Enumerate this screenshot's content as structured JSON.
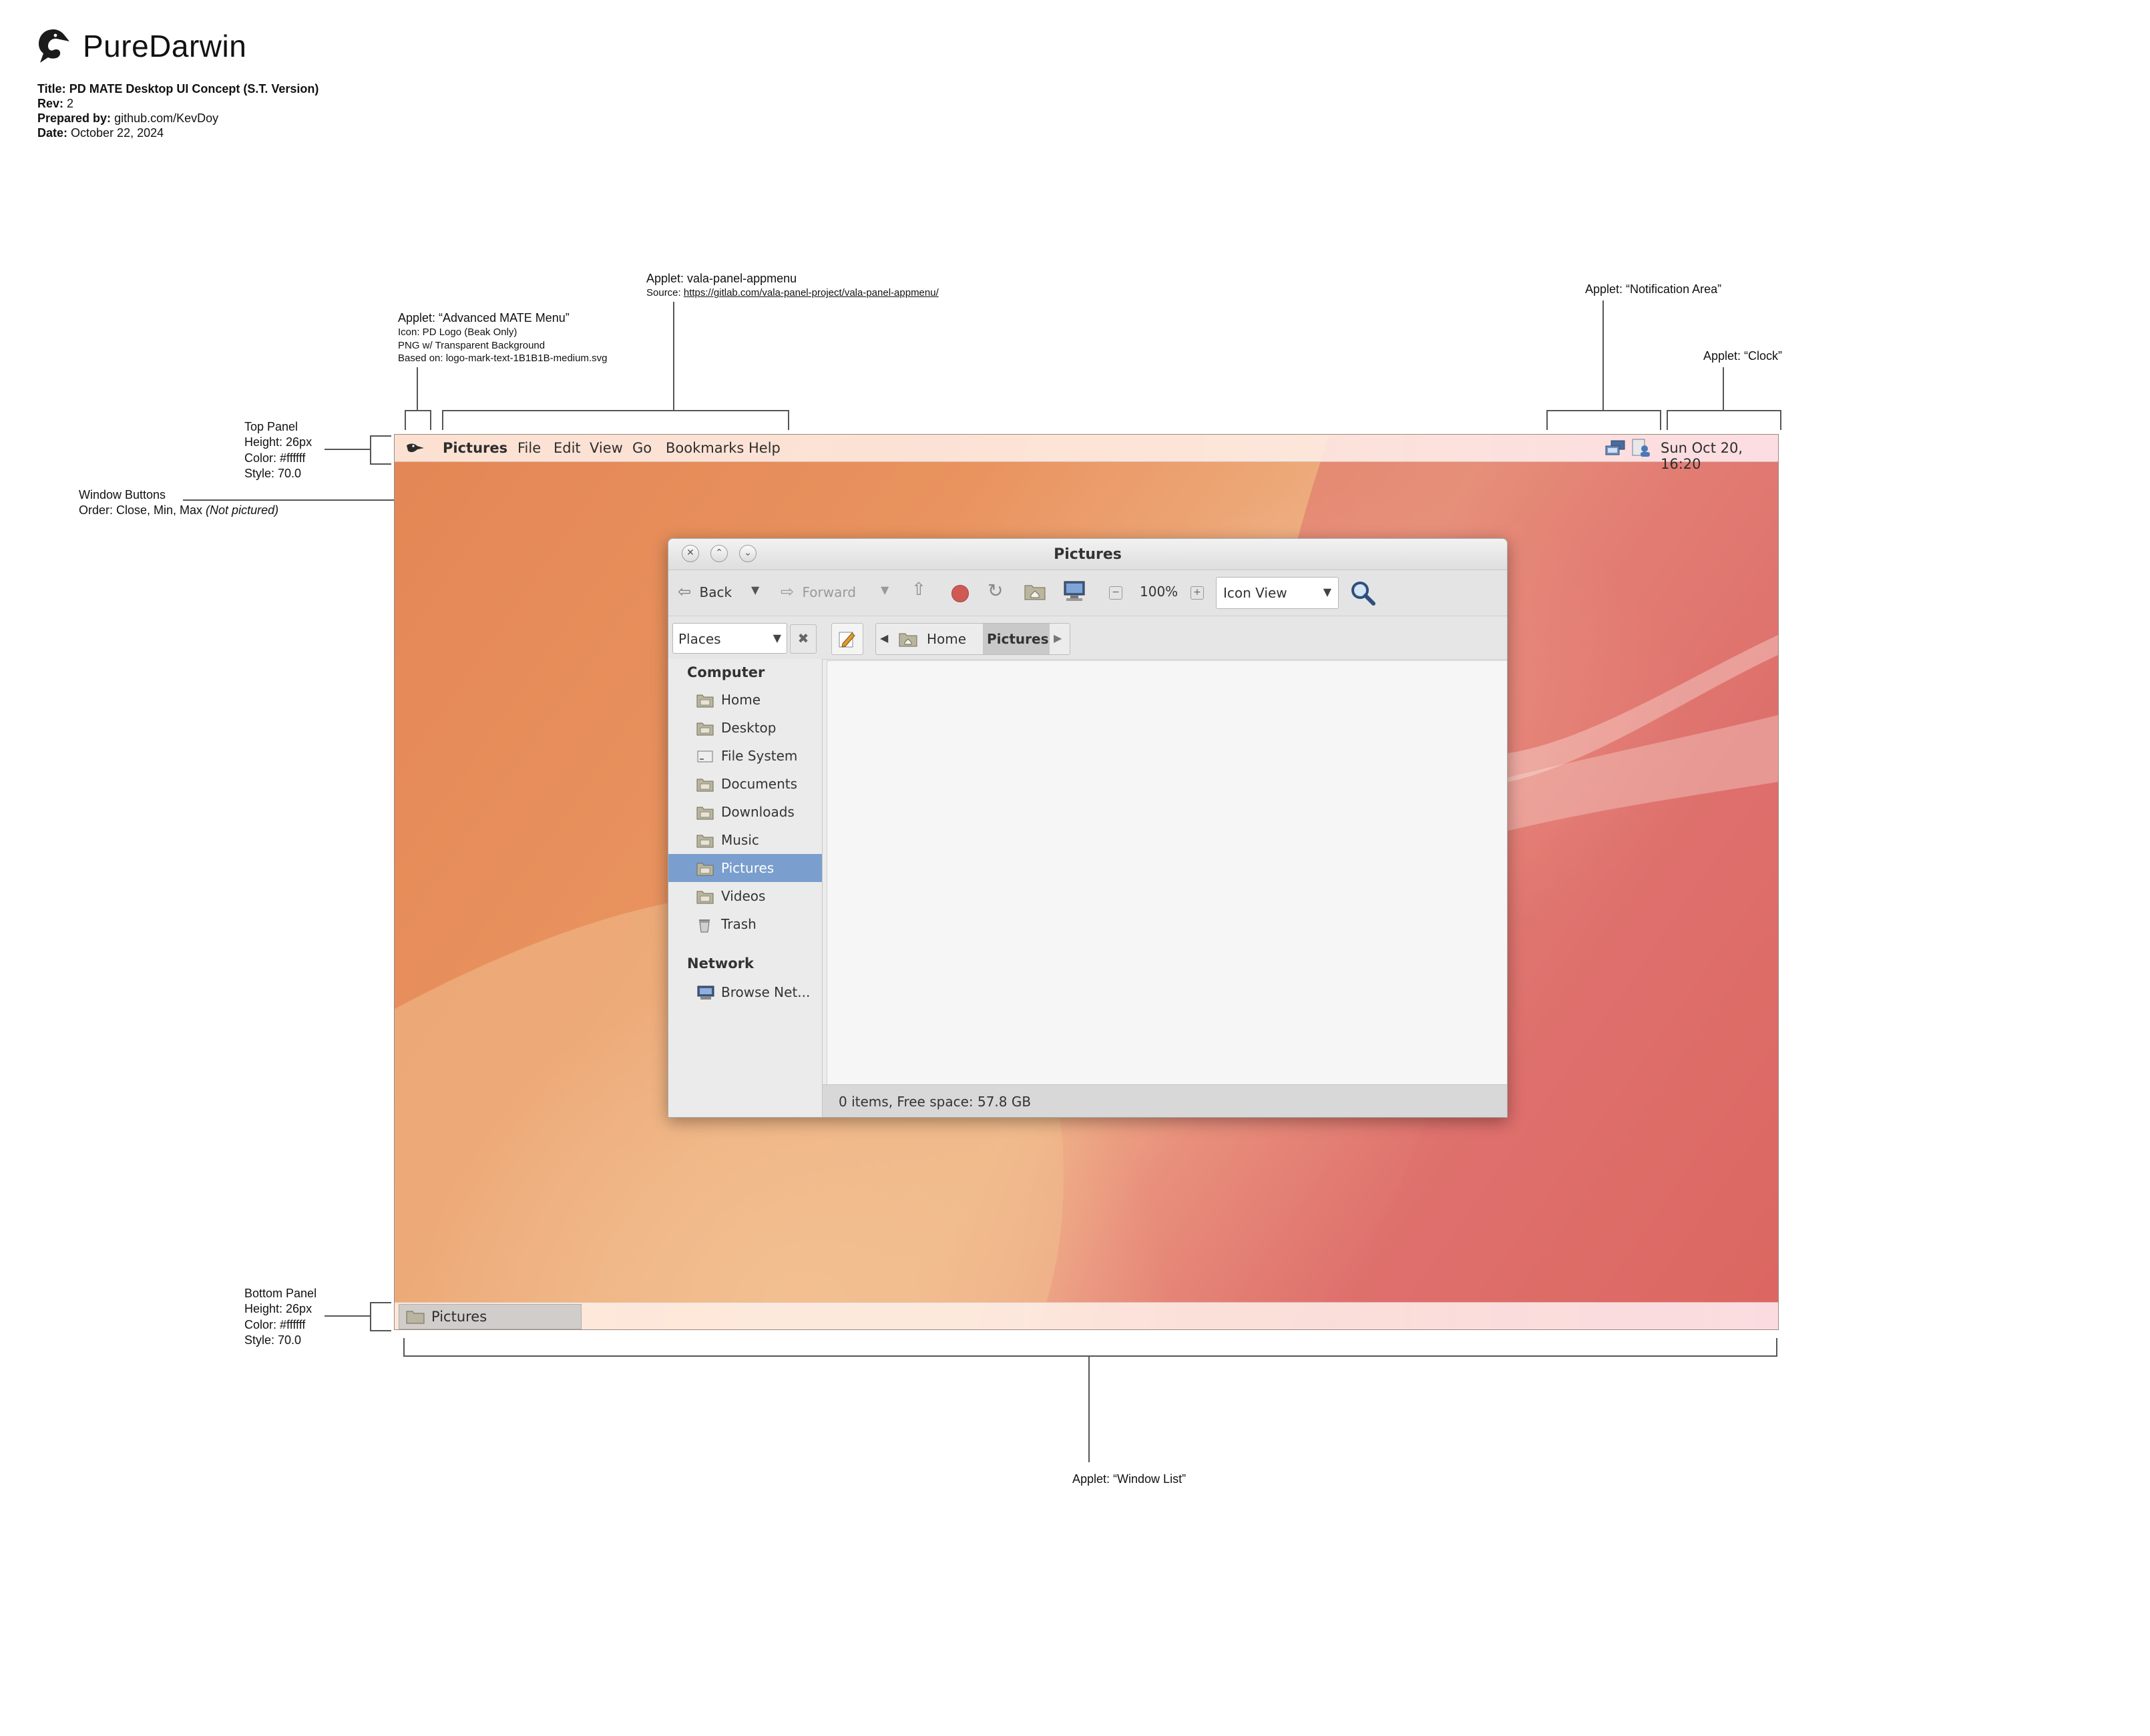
{
  "header": {
    "logo_text": "PureDarwin",
    "meta": [
      {
        "key": "Title:",
        "value": "PD MATE Desktop UI Concept (S.T. Version)",
        "bold_value": true
      },
      {
        "key": "Rev:",
        "value": "2"
      },
      {
        "key": "Prepared by:",
        "value": "github.com/KevDoy"
      },
      {
        "key": "Date:",
        "value": "October 22, 2024"
      }
    ]
  },
  "annotations": {
    "appmenu": {
      "title": "Applet: vala-panel-appmenu",
      "source_label": "Source: ",
      "source_url": "https://gitlab.com/vala-panel-project/vala-panel-appmenu/"
    },
    "mate_menu": {
      "title": "Applet: “Advanced MATE Menu”",
      "lines": [
        "Icon: PD Logo (Beak Only)",
        "PNG w/ Transparent Background",
        "Based on: logo-mark-text-1B1B1B-medium.svg"
      ]
    },
    "notification": {
      "title": "Applet: “Notification Area”"
    },
    "clock": {
      "title": "Applet: “Clock”"
    },
    "top_panel": {
      "lines": [
        "Top Panel",
        "Height: 26px",
        "Color: #ffffff",
        "Style: 70.0"
      ]
    },
    "window_buttons": {
      "title": "Window Buttons",
      "order": "Order: Close, Min, Max ",
      "note": "(Not pictured)"
    },
    "bottom_panel": {
      "lines": [
        "Bottom Panel",
        "Height: 26px",
        "Color: #ffffff",
        "Style: 70.0"
      ]
    },
    "window_list": {
      "title": "Applet: “Window List”"
    }
  },
  "top_panel": {
    "app_name": "Pictures",
    "menus": [
      "File",
      "Edit",
      "View",
      "Go",
      "Bookmarks",
      "Help"
    ],
    "clock": "Sun Oct 20, 16:20"
  },
  "window": {
    "title": "Pictures",
    "toolbar": {
      "back": "Back",
      "forward": "Forward",
      "zoom": "100%",
      "view_mode": "Icon View"
    },
    "location": {
      "sidebar_mode": "Places",
      "crumbs": [
        "Home",
        "Pictures"
      ]
    },
    "sidebar": {
      "computer_header": "Computer",
      "computer_items": [
        "Home",
        "Desktop",
        "File System",
        "Documents",
        "Downloads",
        "Music",
        "Pictures",
        "Videos",
        "Trash"
      ],
      "network_header": "Network",
      "network_items": [
        "Browse Net..."
      ]
    },
    "status": "0 items, Free space: 57.8 GB"
  },
  "bottom_panel": {
    "task_label": "Pictures"
  },
  "colors": {
    "selection": "#7a9ecd",
    "panel": "#ffffff"
  }
}
